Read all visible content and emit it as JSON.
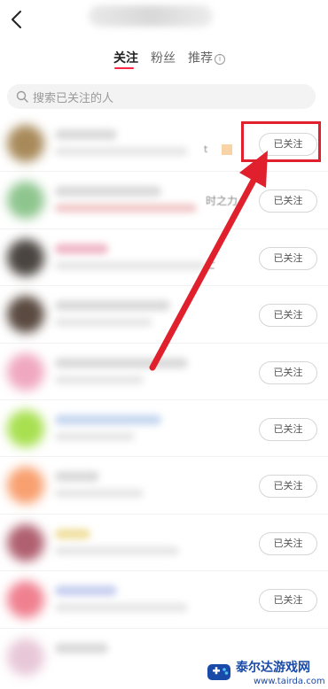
{
  "header": {
    "back_icon": "chevron-left-icon"
  },
  "tabs": [
    {
      "label": "关注",
      "active": true
    },
    {
      "label": "粉丝",
      "active": false
    },
    {
      "label": "推荐",
      "active": false
    }
  ],
  "info_icon_glyph": "i",
  "search": {
    "placeholder": "搜索已关注的人",
    "icon": "search-icon"
  },
  "rows": [
    {
      "button": "已关注",
      "fragment": "t"
    },
    {
      "button": "已关注",
      "fragment": "时之力"
    },
    {
      "button": "已关注",
      "fragment": "亡"
    },
    {
      "button": "已关注",
      "fragment": ""
    },
    {
      "button": "已关注",
      "fragment": ""
    },
    {
      "button": "已关注",
      "fragment": ""
    },
    {
      "button": "已关注",
      "fragment": ""
    },
    {
      "button": "已关注",
      "fragment": ""
    },
    {
      "button": "已关注",
      "fragment": ""
    }
  ],
  "annotation": {
    "highlight_color": "#e0202c",
    "arrow_color": "#e0202c"
  },
  "accent_color": "#ff2442",
  "watermark": {
    "name": "泰尔达游戏网",
    "url": "www.tairda.com"
  }
}
